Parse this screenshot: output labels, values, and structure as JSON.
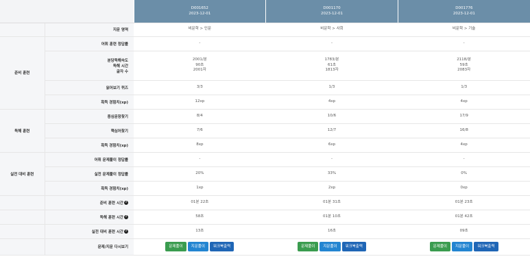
{
  "docs": [
    {
      "id": "D001652",
      "date": "2023-12-01"
    },
    {
      "id": "D001170",
      "date": "2023-12-01"
    },
    {
      "id": "D001776",
      "date": "2023-12-01"
    }
  ],
  "categories": {
    "prep": "준비 훈련",
    "reading": "독해 훈련",
    "practice": "실전 대비 훈련"
  },
  "labels": {
    "domain": "지문 영역",
    "vocab_accuracy": "어휘 훈련 정답률",
    "speed_line1": "분당독해속도",
    "speed_line2": "독해 시간",
    "speed_line3": "글자 수",
    "preview_quiz": "읽어보기 퀴즈",
    "xp": "획득 경험치(xp)",
    "central_sentence": "중심문장찾기",
    "keyword": "핵심어찾기",
    "practice_vocab": "어휘 문제풀이 정답률",
    "practice_accuracy": "실전 문제풀이 정답률",
    "prep_time": "준비 훈련 시간",
    "reading_time": "독해 훈련 시간",
    "practice_time": "실전 대비 훈련 시간",
    "review": "문제/지문 다시보기"
  },
  "rows": {
    "domain": [
      "비문학 > 인문",
      "비문학 > 사회",
      "비문학 > 기술"
    ],
    "vocab_accuracy": [
      "-",
      "-",
      "-"
    ],
    "speed": [
      "2001/분",
      "1783/분",
      "2118/분"
    ],
    "reading_time": [
      "90초",
      "61초",
      "59초"
    ],
    "char_count": [
      "2001자",
      "1813자",
      "2083자"
    ],
    "preview_quiz": [
      "3/3",
      "1/3",
      "1/3"
    ],
    "prep_xp": [
      "12xp",
      "4xp",
      "4xp"
    ],
    "central_sentence": [
      "8/4",
      "10/6",
      "17/9"
    ],
    "keyword": [
      "7/6",
      "12/7",
      "16/8"
    ],
    "reading_xp": [
      "8xp",
      "6xp",
      "4xp"
    ],
    "practice_vocab": [
      "-",
      "-",
      "-"
    ],
    "practice_accuracy": [
      "20%",
      "33%",
      "0%"
    ],
    "practice_xp": [
      "1xp",
      "2xp",
      "0xp"
    ],
    "prep_time": [
      "01분 22초",
      "01분 31초",
      "01분 23초"
    ],
    "reading_train_time": [
      "58초",
      "01분 10초",
      "01분 42초"
    ],
    "practice_time": [
      "13초",
      "16초",
      "09초"
    ]
  },
  "buttons": {
    "solve": "문제풀이",
    "passage": "지문풀이",
    "workbook": "워크북출력"
  },
  "info_glyph": "i",
  "colors": {
    "header_bg": "#6b8ea8",
    "label_bg": "#f5f6f8",
    "btn_green": "#3a9c4f",
    "btn_blue": "#2385d1",
    "btn_navy": "#1f66b6"
  }
}
